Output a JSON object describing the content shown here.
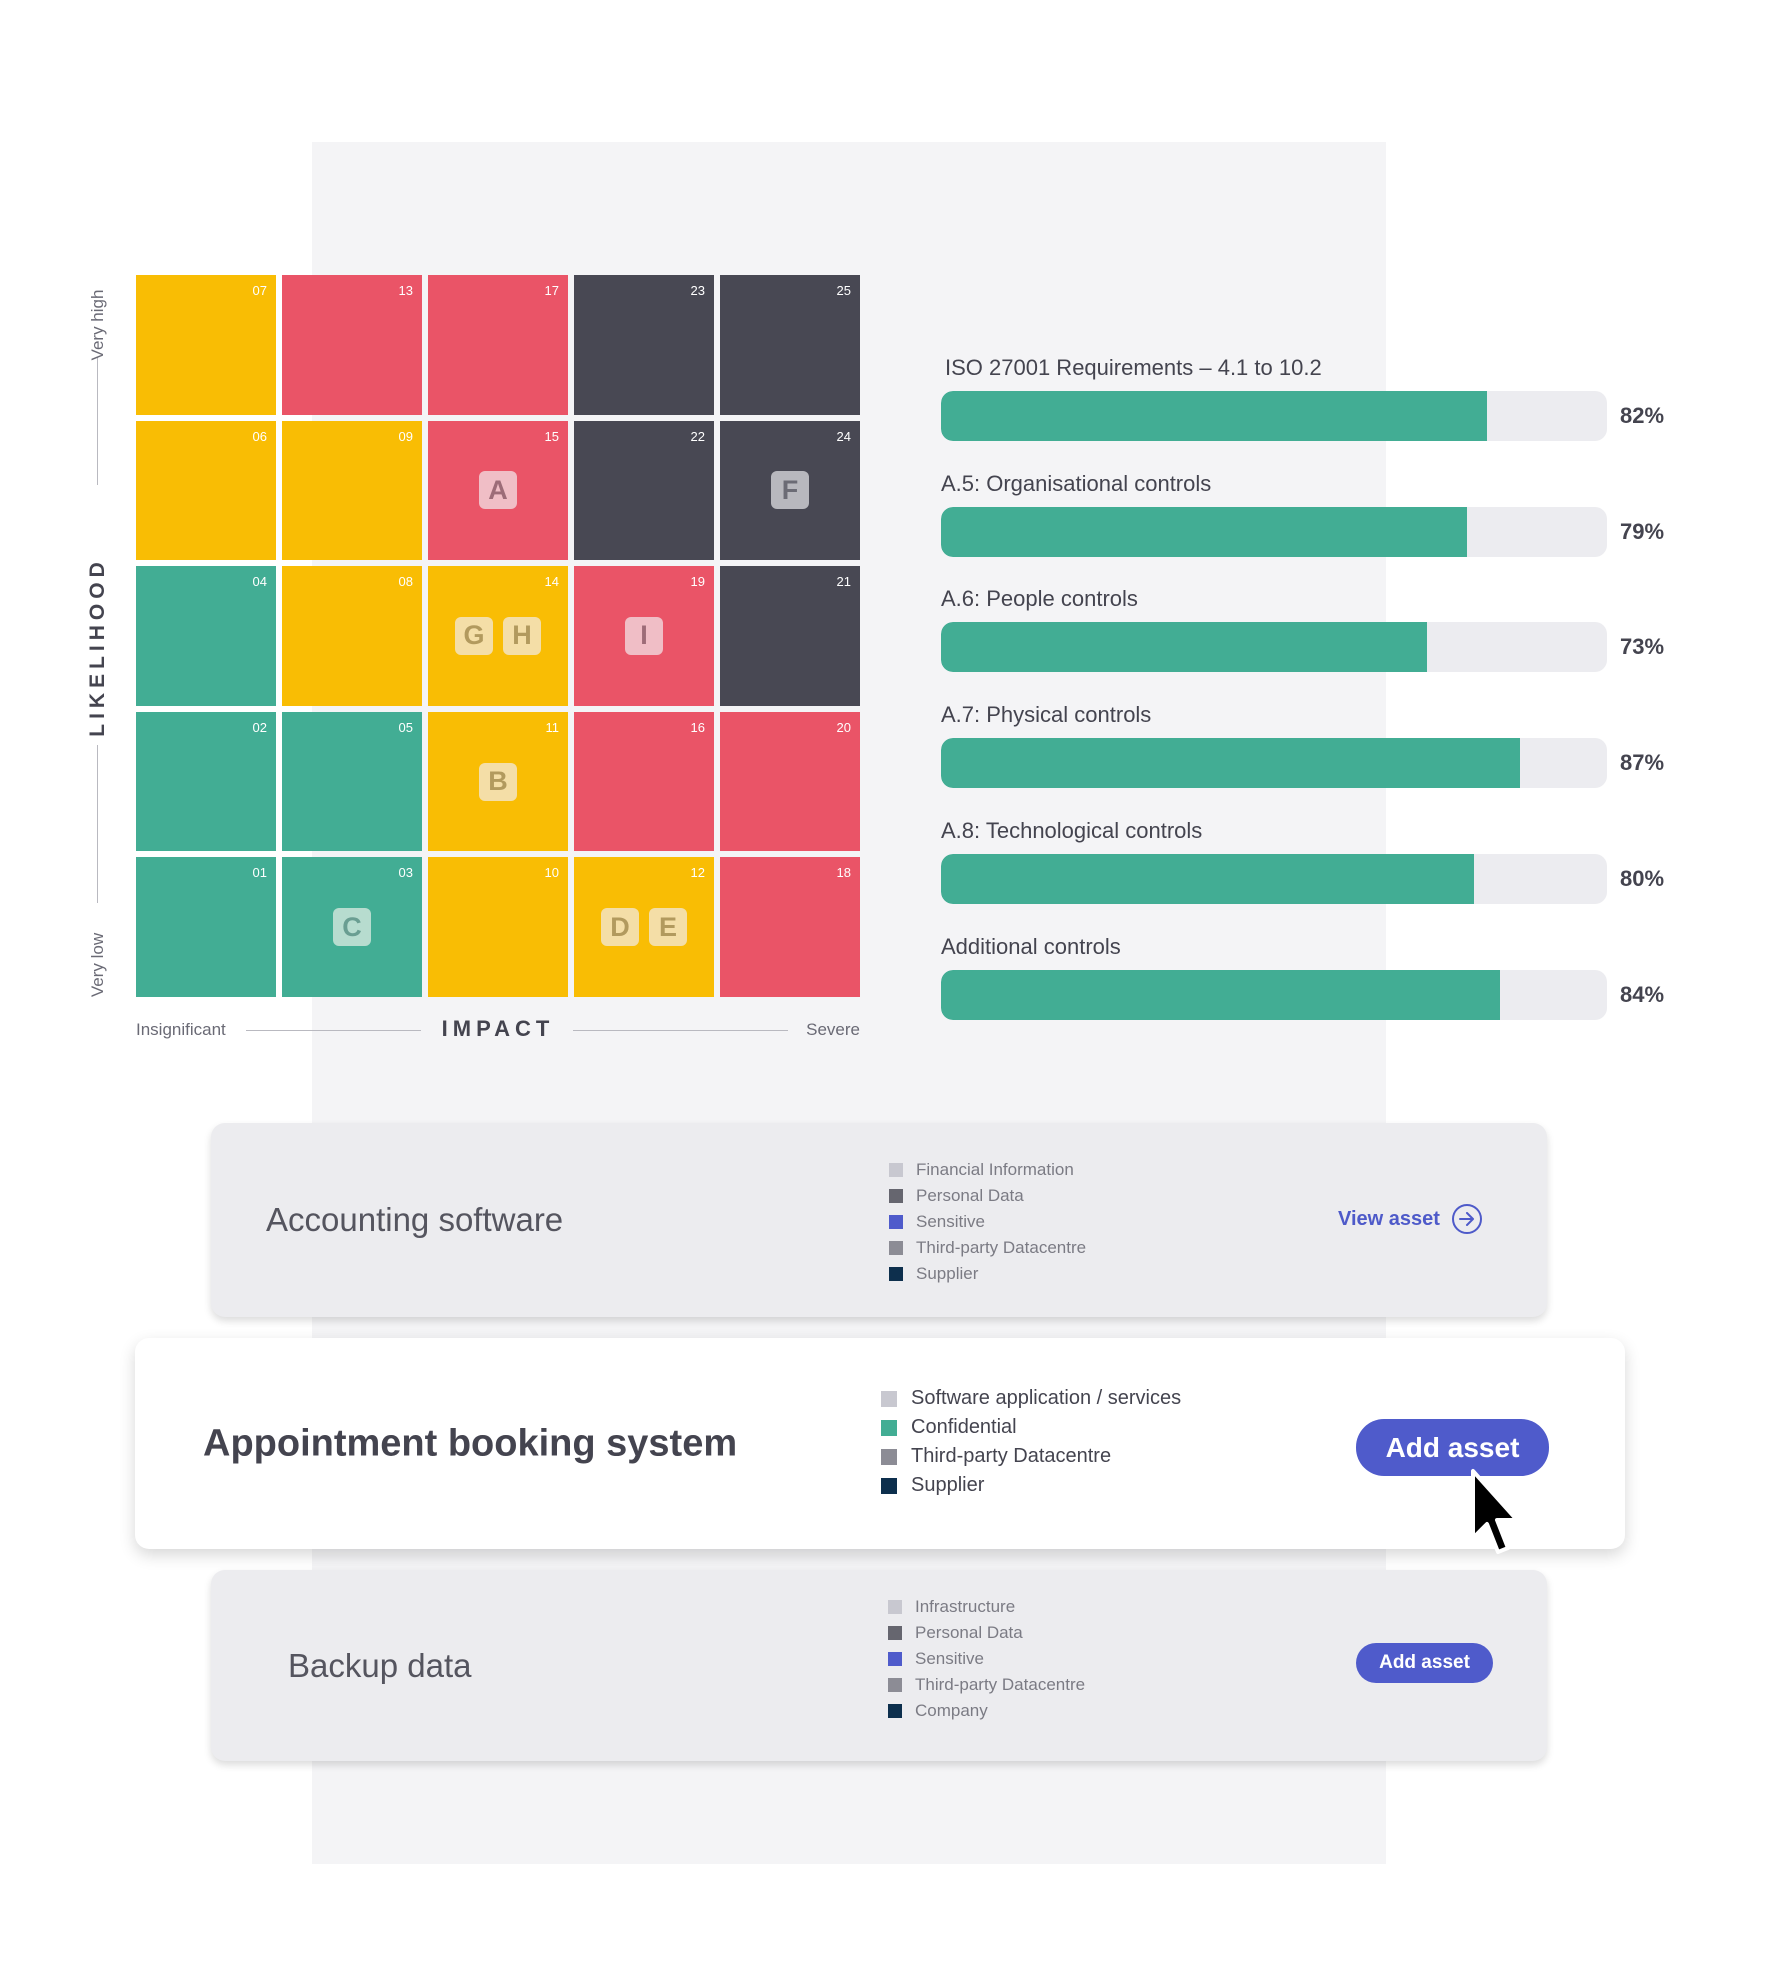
{
  "risk_matrix": {
    "y_axis": {
      "title": "LIKELIHOOD",
      "low": "Very low",
      "high": "Very high"
    },
    "x_axis": {
      "title": "IMPACT",
      "low": "Insignificant",
      "high": "Severe"
    },
    "colors": {
      "green": "#42ad94",
      "yellow": "#f9bd04",
      "red": "#ea5467",
      "dark": "#484853"
    },
    "rows": [
      [
        {
          "num": "07",
          "level": "yellow",
          "tags": []
        },
        {
          "num": "13",
          "level": "red",
          "tags": []
        },
        {
          "num": "17",
          "level": "red",
          "tags": []
        },
        {
          "num": "23",
          "level": "dark",
          "tags": []
        },
        {
          "num": "25",
          "level": "dark",
          "tags": []
        }
      ],
      [
        {
          "num": "06",
          "level": "yellow",
          "tags": []
        },
        {
          "num": "09",
          "level": "yellow",
          "tags": []
        },
        {
          "num": "15",
          "level": "red",
          "tags": [
            "A"
          ]
        },
        {
          "num": "22",
          "level": "dark",
          "tags": []
        },
        {
          "num": "24",
          "level": "dark",
          "tags": [
            "F"
          ]
        }
      ],
      [
        {
          "num": "04",
          "level": "green",
          "tags": []
        },
        {
          "num": "08",
          "level": "yellow",
          "tags": []
        },
        {
          "num": "14",
          "level": "yellow",
          "tags": [
            "G",
            "H"
          ]
        },
        {
          "num": "19",
          "level": "red",
          "tags": [
            "I"
          ]
        },
        {
          "num": "21",
          "level": "dark",
          "tags": []
        }
      ],
      [
        {
          "num": "02",
          "level": "green",
          "tags": []
        },
        {
          "num": "05",
          "level": "green",
          "tags": []
        },
        {
          "num": "11",
          "level": "yellow",
          "tags": [
            "B"
          ]
        },
        {
          "num": "16",
          "level": "red",
          "tags": []
        },
        {
          "num": "20",
          "level": "red",
          "tags": []
        }
      ],
      [
        {
          "num": "01",
          "level": "green",
          "tags": []
        },
        {
          "num": "03",
          "level": "green",
          "tags": [
            "C"
          ]
        },
        {
          "num": "10",
          "level": "yellow",
          "tags": []
        },
        {
          "num": "12",
          "level": "yellow",
          "tags": [
            "D",
            "E"
          ]
        },
        {
          "num": "18",
          "level": "red",
          "tags": []
        }
      ]
    ]
  },
  "chart_data": {
    "type": "bar",
    "orientation": "horizontal",
    "title": "",
    "categories": [
      "ISO 27001 Requirements – 4.1 to 10.2",
      "A.5: Organisational controls",
      "A.6: People controls",
      "A.7: Physical controls",
      "A.8: Technological controls",
      "Additional controls"
    ],
    "values": [
      82,
      79,
      73,
      87,
      80,
      84
    ],
    "value_labels": [
      "82%",
      "79%",
      "73%",
      "87%",
      "80%",
      "84%"
    ],
    "xlim": [
      0,
      100
    ],
    "unit": "%",
    "bar_color": "#42ad94",
    "track_color": "#ececf0"
  },
  "assets": [
    {
      "name": "Accounting software",
      "state": "muted",
      "tags": [
        {
          "label": "Financial Information",
          "color": "#c8c8d0"
        },
        {
          "label": "Personal Data",
          "color": "#66666f"
        },
        {
          "label": "Sensitive",
          "color": "#4f5bcb"
        },
        {
          "label": "Third-party Datacentre",
          "color": "#8c8c95"
        },
        {
          "label": "Supplier",
          "color": "#0d2f4d"
        }
      ],
      "action": {
        "label": "View asset",
        "icon": "arrow-right-circle-icon"
      }
    },
    {
      "name": "Appointment booking system",
      "state": "active",
      "tags": [
        {
          "label": "Software application / services",
          "color": "#c8c8d0"
        },
        {
          "label": "Confidential",
          "color": "#42ad94"
        },
        {
          "label": "Third-party Datacentre",
          "color": "#8c8c95"
        },
        {
          "label": "Supplier",
          "color": "#0d2f4d"
        }
      ],
      "action": {
        "label": "Add asset"
      }
    },
    {
      "name": "Backup data",
      "state": "muted",
      "tags": [
        {
          "label": "Infrastructure",
          "color": "#c8c8d0"
        },
        {
          "label": "Personal Data",
          "color": "#66666f"
        },
        {
          "label": "Sensitive",
          "color": "#4f5bcb"
        },
        {
          "label": "Third-party Datacentre",
          "color": "#8c8c95"
        },
        {
          "label": "Company",
          "color": "#0d2f4d"
        }
      ],
      "action": {
        "label": "Add asset"
      }
    }
  ],
  "accent_color": "#4f5bcb"
}
